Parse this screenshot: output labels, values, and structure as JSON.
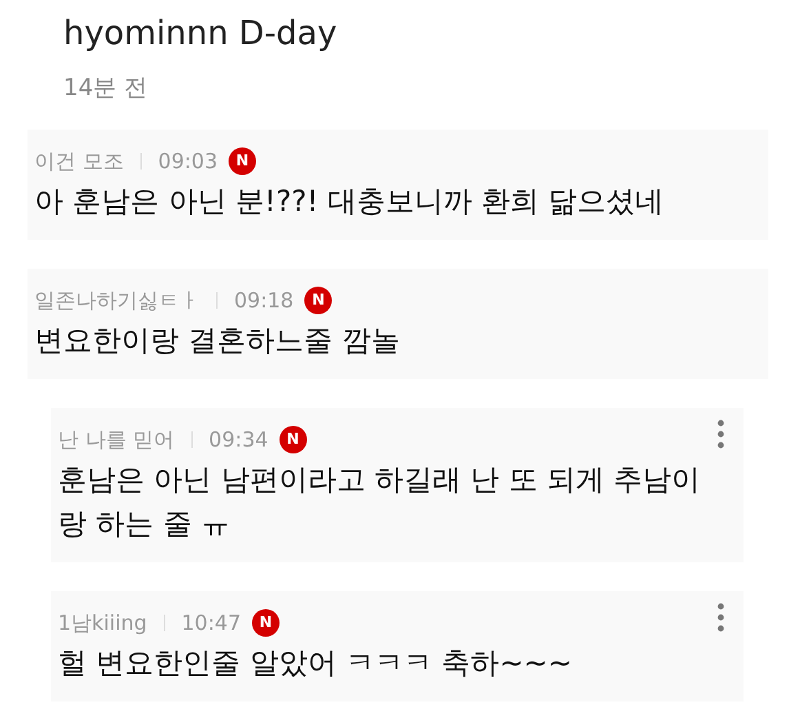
{
  "post": {
    "title": "hyominnn D-day",
    "time": "14분 전"
  },
  "comments": [
    {
      "kind": "comment",
      "author": "이건 모조",
      "time": "09:03",
      "badge": "N",
      "text": "아 훈남은 아닌 분!??! 대충보니까 환희 닮으셨네"
    },
    {
      "kind": "comment",
      "author": "일존나하기싫ㅌㅏ",
      "time": "09:18",
      "badge": "N",
      "text": "변요한이랑 결혼하느줄 깜놀"
    },
    {
      "kind": "reply",
      "author": "난 나를 믿어",
      "time": "09:34",
      "badge": "N",
      "text": "훈남은 아닌 남편이라고 하길래 난 또 되게 추남이랑 하는 줄 ㅠ"
    },
    {
      "kind": "reply",
      "author": "1남kiiing",
      "time": "10:47",
      "badge": "N",
      "text": "헐 변요한인줄 알았어 ㅋㅋㅋ 축하~~~"
    }
  ]
}
